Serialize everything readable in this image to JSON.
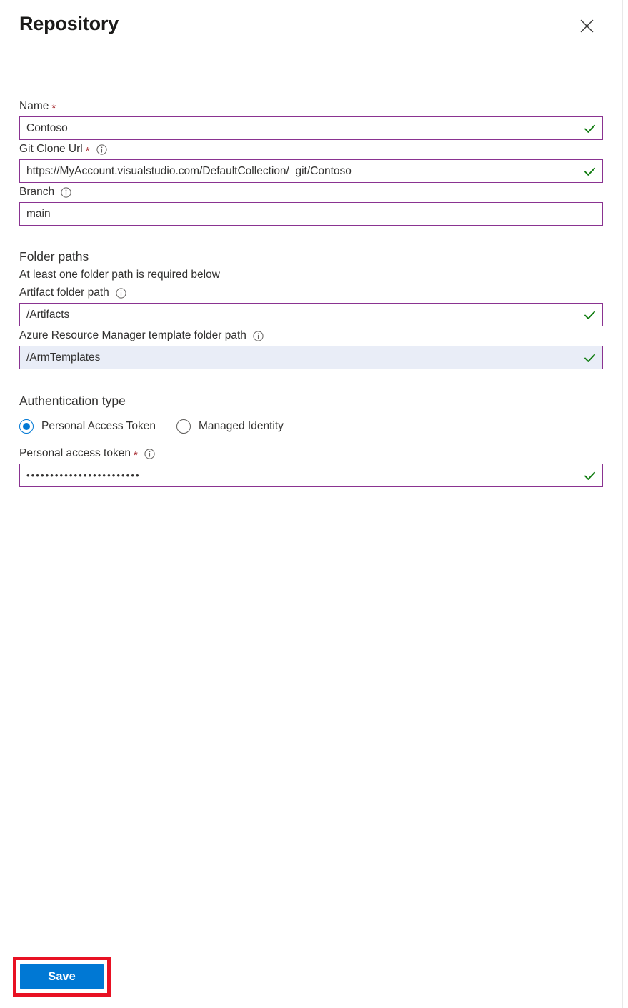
{
  "header": {
    "title": "Repository",
    "close_label": "Close",
    "close_icon": "close-icon"
  },
  "fields": {
    "name": {
      "label": "Name",
      "required": true,
      "has_info": false,
      "value": "Contoso",
      "valid": true
    },
    "git_clone_url": {
      "label": "Git Clone Url",
      "required": true,
      "has_info": true,
      "value": "https://MyAccount.visualstudio.com/DefaultCollection/_git/Contoso",
      "valid": true
    },
    "branch": {
      "label": "Branch",
      "required": false,
      "has_info": true,
      "value": "main",
      "valid": false
    },
    "artifact_folder_path": {
      "label": "Artifact folder path",
      "required": false,
      "has_info": true,
      "value": "/Artifacts",
      "valid": true
    },
    "arm_template_folder_path": {
      "label": "Azure Resource Manager template folder path",
      "required": false,
      "has_info": true,
      "value": "/ArmTemplates",
      "valid": true,
      "focused": true
    },
    "personal_access_token": {
      "label": "Personal access token",
      "required": true,
      "has_info": true,
      "value": "••••••••••••••••••••••••",
      "valid": true
    }
  },
  "sections": {
    "folder_paths": {
      "heading": "Folder paths",
      "subtext": "At least one folder path is required below"
    },
    "authentication": {
      "heading": "Authentication type",
      "options": [
        {
          "label": "Personal Access Token",
          "selected": true
        },
        {
          "label": "Managed Identity",
          "selected": false
        }
      ]
    }
  },
  "footer": {
    "save_label": "Save"
  },
  "colors": {
    "accent": "#0078d4",
    "field_border": "#8a3391",
    "valid_check": "#107c10",
    "required_star": "#a4262c",
    "highlight_box": "#e81123",
    "focused_field_bg": "#e9edf7"
  }
}
